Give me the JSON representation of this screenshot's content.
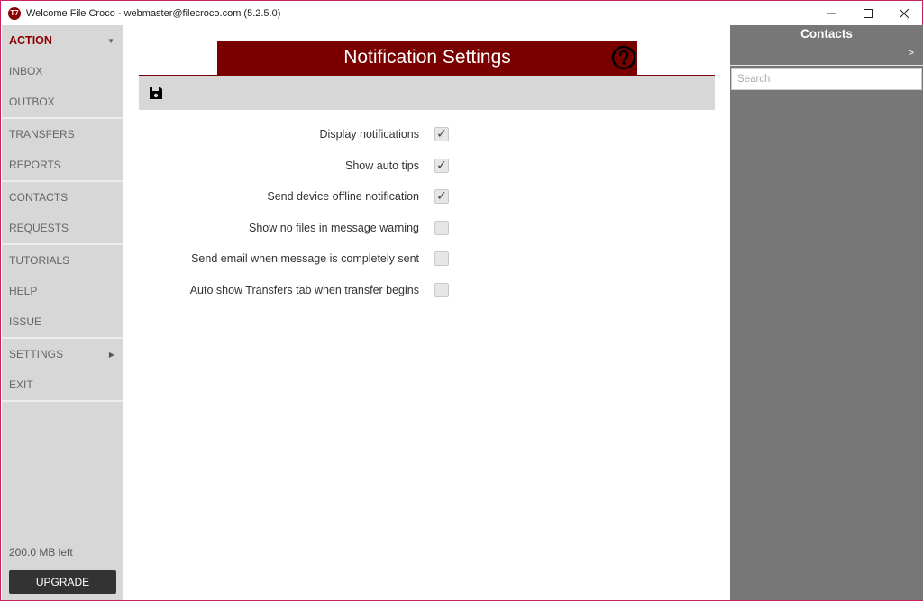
{
  "window": {
    "title": "Welcome  File Croco - webmaster@filecroco.com (5.2.5.0)",
    "app_icon_text": "T7"
  },
  "sidebar": {
    "groups": [
      [
        {
          "label": "ACTION",
          "active": true,
          "arrow": "down"
        },
        {
          "label": "INBOX"
        },
        {
          "label": "OUTBOX"
        }
      ],
      [
        {
          "label": "TRANSFERS"
        },
        {
          "label": "REPORTS"
        }
      ],
      [
        {
          "label": "CONTACTS"
        },
        {
          "label": "REQUESTS"
        }
      ],
      [
        {
          "label": "TUTORIALS"
        },
        {
          "label": "HELP"
        },
        {
          "label": "ISSUE"
        }
      ],
      [
        {
          "label": "SETTINGS",
          "arrow": "right"
        },
        {
          "label": "EXIT"
        }
      ]
    ],
    "storage": "200.0 MB left",
    "upgrade_label": "UPGRADE"
  },
  "main": {
    "title": "Notification Settings",
    "settings": [
      {
        "label": "Display notifications",
        "checked": true
      },
      {
        "label": "Show auto tips",
        "checked": true
      },
      {
        "label": "Send device offline notification",
        "checked": true
      },
      {
        "label": "Show no files in message warning",
        "checked": false
      },
      {
        "label": "Send email when message is completely sent",
        "checked": false
      },
      {
        "label": "Auto show Transfers tab when transfer begins",
        "checked": false
      }
    ]
  },
  "contacts": {
    "title": "Contacts",
    "expand": ">",
    "search_placeholder": "Search"
  },
  "colors": {
    "brand": "#7a0000",
    "sidebar_bg": "#d7d7d7",
    "contacts_bg": "#777777",
    "window_border": "#c9235f"
  }
}
